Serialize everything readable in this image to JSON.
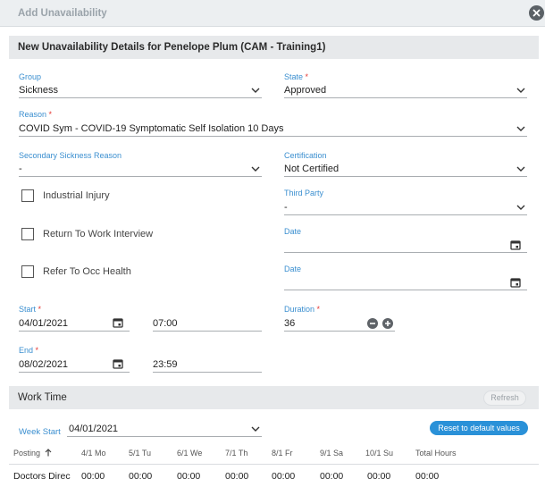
{
  "window": {
    "title": "Add Unavailability",
    "close_icon": "close-icon"
  },
  "details_section": {
    "title": "New Unavailability Details for Penelope Plum (CAM - Training1)"
  },
  "form": {
    "group": {
      "label": "Group",
      "value": "Sickness"
    },
    "state": {
      "label": "State",
      "required_mark": "*",
      "value": "Approved"
    },
    "reason": {
      "label": "Reason",
      "required_mark": "*",
      "value": "COVID Sym - COVID-19 Symptomatic Self Isolation 10 Days"
    },
    "secondary_reason": {
      "label": "Secondary Sickness Reason",
      "value": "-"
    },
    "certification": {
      "label": "Certification",
      "value": "Not Certified"
    },
    "third_party": {
      "label": "Third Party",
      "value": "-"
    },
    "date1": {
      "label": "Date",
      "value": ""
    },
    "date2": {
      "label": "Date",
      "value": ""
    },
    "checkboxes": [
      {
        "label": "Industrial Injury",
        "checked": false
      },
      {
        "label": "Return To Work Interview",
        "checked": false
      },
      {
        "label": "Refer To Occ Health",
        "checked": false
      }
    ],
    "start": {
      "label": "Start",
      "required_mark": "*",
      "date": "04/01/2021",
      "time": "07:00"
    },
    "end": {
      "label": "End",
      "required_mark": "*",
      "date": "08/02/2021",
      "time": "23:59"
    },
    "duration": {
      "label": "Duration",
      "required_mark": "*",
      "value": "36"
    }
  },
  "work_time": {
    "title": "Work Time",
    "refresh_label": "Refresh",
    "week_start_label": "Week Start",
    "week_start_value": "04/01/2021",
    "reset_label": "Reset to default values",
    "columns": [
      "Posting",
      "4/1 Mo",
      "5/1 Tu",
      "6/1 We",
      "7/1 Th",
      "8/1 Fr",
      "9/1 Sa",
      "10/1 Su",
      "Total Hours"
    ],
    "sort_icon": "sort-arrow-up-icon",
    "rows": [
      {
        "posting": "Doctors Direc",
        "cells": [
          "00:00",
          "00:00",
          "00:00",
          "00:00",
          "00:00",
          "00:00",
          "00:00",
          "00:00"
        ]
      }
    ]
  },
  "colors": {
    "accent": "#2a91d8",
    "label_blue": "#3b8fd0",
    "required_red": "#e53935",
    "section_bg": "#e7e9eb"
  }
}
